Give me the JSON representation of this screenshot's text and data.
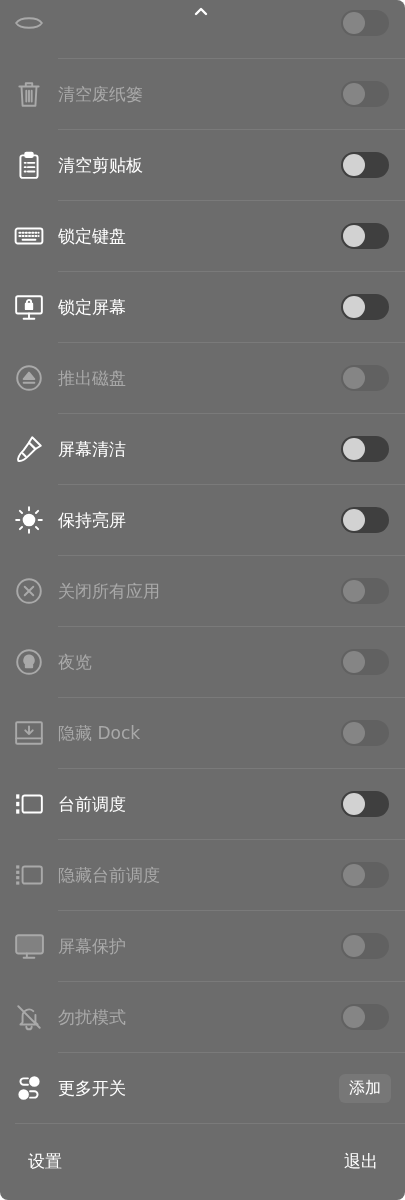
{
  "top_row": {
    "kind": "toggle",
    "disabled": true,
    "on": false
  },
  "rows": [
    {
      "kind": "toggle",
      "label": "清空废纸篓",
      "disabled": true,
      "on": false
    },
    {
      "kind": "toggle",
      "label": "清空剪贴板",
      "disabled": false,
      "on": false
    },
    {
      "kind": "toggle",
      "label": "锁定键盘",
      "disabled": false,
      "on": false
    },
    {
      "kind": "toggle",
      "label": "锁定屏幕",
      "disabled": false,
      "on": false
    },
    {
      "kind": "toggle",
      "label": "推出磁盘",
      "disabled": true,
      "on": false
    },
    {
      "kind": "toggle",
      "label": "屏幕清洁",
      "disabled": false,
      "on": false
    },
    {
      "kind": "toggle",
      "label": "保持亮屏",
      "disabled": false,
      "on": false
    },
    {
      "kind": "toggle",
      "label": "关闭所有应用",
      "disabled": true,
      "on": false
    },
    {
      "kind": "toggle",
      "label": "夜览",
      "disabled": true,
      "on": false
    },
    {
      "kind": "toggle",
      "label": "隐藏 Dock",
      "disabled": true,
      "on": false
    },
    {
      "kind": "toggle",
      "label": "台前调度",
      "disabled": false,
      "on": false
    },
    {
      "kind": "toggle",
      "label": "隐藏台前调度",
      "disabled": true,
      "on": false
    },
    {
      "kind": "toggle",
      "label": "屏幕保护",
      "disabled": true,
      "on": false
    },
    {
      "kind": "toggle",
      "label": "勿扰模式",
      "disabled": true,
      "on": false
    },
    {
      "kind": "button",
      "label": "更多开关",
      "button": "添加"
    }
  ],
  "footer": {
    "settings": "设置",
    "quit": "退出"
  }
}
